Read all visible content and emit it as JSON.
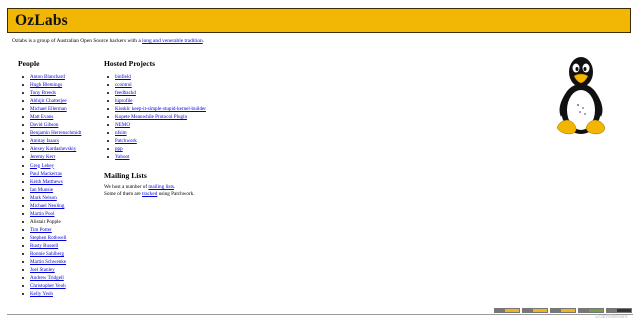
{
  "banner": {
    "title": "OzLabs"
  },
  "intro": {
    "text_before": "Ozlabs is a group of Australian Open Source hackers with a ",
    "link_label": "long and venerable tradition",
    "text_after": "."
  },
  "people": {
    "heading": "People",
    "members": [
      {
        "name": "Anton Blanchard",
        "linked": true
      },
      {
        "name": "Hugh Blemings",
        "linked": true
      },
      {
        "name": "Tony Breeds",
        "linked": true
      },
      {
        "name": "Abhijit Chatterjee",
        "linked": true
      },
      {
        "name": "Michael Ellerman",
        "linked": true
      },
      {
        "name": "Matt Evans",
        "linked": true
      },
      {
        "name": "David Gibson",
        "linked": true
      },
      {
        "name": "Benjamin Herrenschmidt",
        "linked": true
      },
      {
        "name": "Amitay Isaacs",
        "linked": true
      },
      {
        "name": "Alexey Kardashevskiy",
        "linked": true
      },
      {
        "name": "Jeremy Kerr",
        "linked": true
      },
      {
        "name": "Greg Lehey",
        "linked": true
      },
      {
        "name": "Paul Mackerras",
        "linked": true
      },
      {
        "name": "Keith Matthews",
        "linked": true
      },
      {
        "name": "Ian Munsie",
        "linked": true
      },
      {
        "name": "Mark Nelson",
        "linked": true
      },
      {
        "name": "Michael Neuling",
        "linked": true
      },
      {
        "name": "Martin Pool",
        "linked": true
      },
      {
        "name": "Alistair Popple",
        "linked": false
      },
      {
        "name": "Tim Potter",
        "linked": true
      },
      {
        "name": "Stephen Rothwell",
        "linked": true
      },
      {
        "name": "Rusty Russell",
        "linked": true
      },
      {
        "name": "Ronnie Sahlberg",
        "linked": true
      },
      {
        "name": "Martin Schwenke",
        "linked": true
      },
      {
        "name": "Joel Stanley",
        "linked": true
      },
      {
        "name": "Andrew Tridgell",
        "linked": true
      },
      {
        "name": "Christopher Yeoh",
        "linked": true
      },
      {
        "name": "Kelly Yeoh",
        "linked": true
      }
    ]
  },
  "projects": {
    "heading": "Hosted Projects",
    "items": [
      "binfield",
      "ccontrol",
      "feedbackd",
      "hiprofile",
      "Kisskb: keep-it-simple-stupid-kernel-builder",
      "Kopete Meanwhile Protocol Plugin",
      "NEMO",
      "nfsim",
      "Patchwork",
      "ppp",
      "Yaboot"
    ]
  },
  "mailing": {
    "heading": "Mailing Lists",
    "line1_before": "We host a number of ",
    "line1_link": "mailing lists",
    "line1_after": ".",
    "line2_before": "Some of them are ",
    "line2_link": "tracked",
    "line2_after": " using Patchwork."
  },
  "footer": {
    "watermark": "ScanMalware",
    "badge_colors": [
      "#f3b31a",
      "#f3b31a",
      "#f3b31a",
      "#6fa04a",
      "#333333"
    ]
  },
  "colors": {
    "banner": "#f2b604",
    "link": "#0000d6"
  },
  "icons": {
    "mascot": "tux-penguin-icon"
  }
}
